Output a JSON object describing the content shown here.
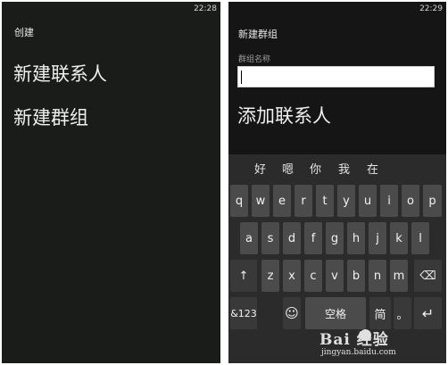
{
  "left_screen": {
    "status_time": "22:28",
    "header": "创建",
    "options": [
      "新建联系人",
      "新建群组"
    ]
  },
  "right_screen": {
    "status_time": "22:29",
    "header": "新建群组",
    "group_name_label": "群组名称",
    "group_name_value": "",
    "add_contact": "添加联系人",
    "keyboard": {
      "suggestions": [
        "好",
        "嗯",
        "你",
        "我",
        "在"
      ],
      "row1": [
        "q",
        "w",
        "e",
        "r",
        "t",
        "y",
        "u",
        "i",
        "o",
        "p"
      ],
      "row2": [
        "a",
        "s",
        "d",
        "f",
        "g",
        "h",
        "j",
        "k",
        "l"
      ],
      "row3_letters": [
        "z",
        "x",
        "c",
        "v",
        "b",
        "n",
        "m"
      ],
      "shift": "↑",
      "backspace": "⌫",
      "numbers": "&123",
      "emoji": "☺",
      "space": "空格",
      "lang": "简",
      "period": "。",
      "enter": "↵"
    }
  },
  "watermark": {
    "main": "Bai  经验",
    "sub": "jingyan.baidu.com"
  }
}
